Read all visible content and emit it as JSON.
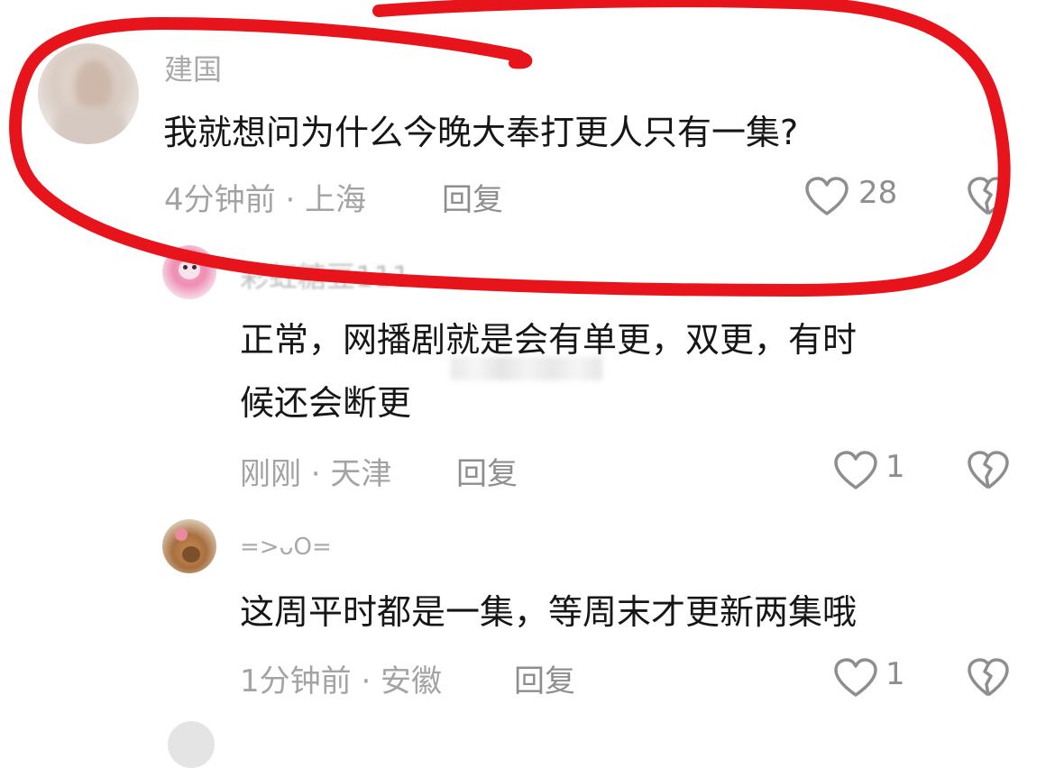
{
  "comments": [
    {
      "username": "建国",
      "text": "我就想问为什么今晚大奉打更人只有一集?",
      "meta": "4分钟前 · 上海",
      "reply_label": "回复",
      "likes": "28"
    },
    {
      "username": "彩虹糖豆111",
      "text_line1": "正常，网播剧就是会有单更，双更，有时",
      "text_line2": "候还会断更",
      "meta": "刚刚 · 天津",
      "reply_label": "回复",
      "likes": "1"
    },
    {
      "username": "=>ᴗO=",
      "text": "这周平时都是一集，等周末才更新两集哦",
      "meta": "1分钟前 · 安徽",
      "reply_label": "回复",
      "likes": "1"
    }
  ],
  "icons": {
    "like": "heart-outline-icon",
    "dislike": "broken-heart-icon"
  },
  "colors": {
    "annotation_red": "#e8141c",
    "body_text": "#161616",
    "meta_text": "#a3a3a3"
  }
}
